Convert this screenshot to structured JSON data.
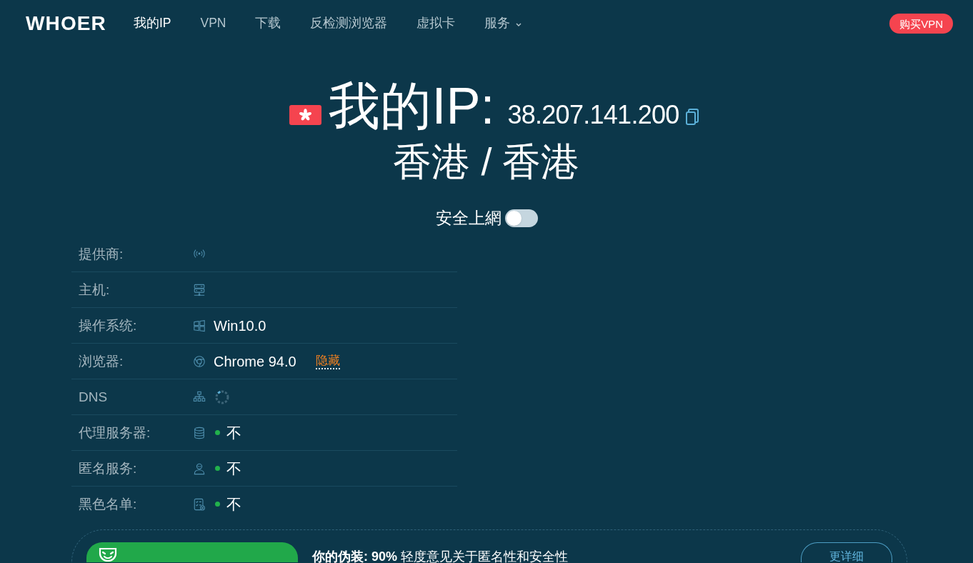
{
  "header": {
    "logo": "WHOER",
    "nav": [
      {
        "label": "我的IP",
        "selected": true,
        "dropdown": false
      },
      {
        "label": "VPN",
        "selected": false,
        "dropdown": false
      },
      {
        "label": "下载",
        "selected": false,
        "dropdown": false
      },
      {
        "label": "反检测浏览器",
        "selected": false,
        "dropdown": false
      },
      {
        "label": "虚拟卡",
        "selected": false,
        "dropdown": false
      },
      {
        "label": "服务",
        "selected": false,
        "dropdown": true
      }
    ],
    "buy_button": "购买VPN"
  },
  "hero": {
    "title": "我的IP:",
    "ip": "38.207.141.200",
    "location": "香港 / 香港",
    "secure_browsing": {
      "label": "安全上網",
      "on": false
    }
  },
  "details": [
    {
      "label": "提供商:"
    },
    {
      "label": "主机:"
    },
    {
      "label": "操作系统:",
      "value": "Win10.0"
    },
    {
      "label": "浏览器:",
      "value": "Chrome 94.0",
      "link": "隐藏"
    },
    {
      "label": "DNS",
      "loading": true
    },
    {
      "label": "代理服务器:",
      "value": "不",
      "color": "#22b14c"
    },
    {
      "label": "匿名服务:",
      "value": "不",
      "color": "#22b14c"
    },
    {
      "label": "黑色名单:",
      "value": "不",
      "color": "#22b14c"
    }
  ],
  "disguise": {
    "summary": "**你的伪装: 90%** 轻度意见关于匿名性和安全性",
    "button": "更详细"
  }
}
